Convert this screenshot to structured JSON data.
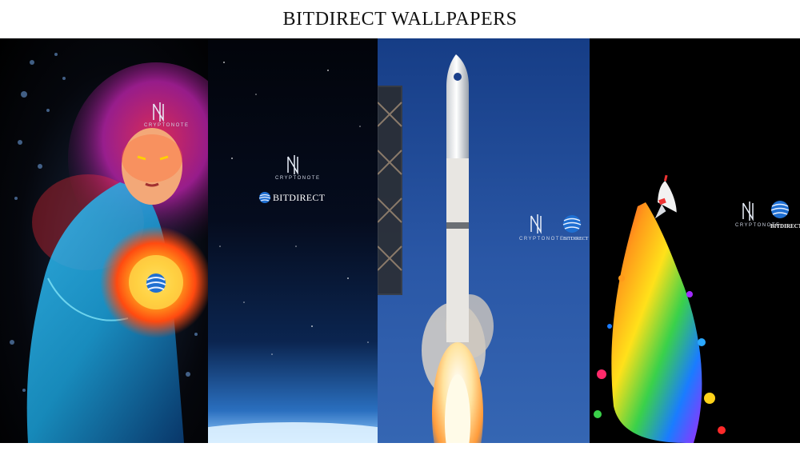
{
  "page": {
    "title": "BITDIRECT WALLPAPERS"
  },
  "wallpapers": [
    {
      "scene": "glowing-figure",
      "logo_text": "CRYPTONOTE"
    },
    {
      "scene": "night-sky-horizon",
      "logo_text": "CRYPTONOTE",
      "brand_text": "BITDIRECT"
    },
    {
      "scene": "rocket-launch",
      "logo_text": "CRYPTONOTE",
      "brand_text": "BITDIRECT"
    },
    {
      "scene": "rainbow-rocket",
      "logo_text": "CRYPTONOTE",
      "brand_text": "BITDIRECT"
    }
  ],
  "colors": {
    "accent_blue": "#1f6fd1",
    "fire_orange": "#ff7a1a",
    "sky_blue": "#2a57a6"
  },
  "icons": {
    "cryptonote": "cryptonote-logo-icon",
    "bitdirect": "bitdirect-globe-icon"
  }
}
